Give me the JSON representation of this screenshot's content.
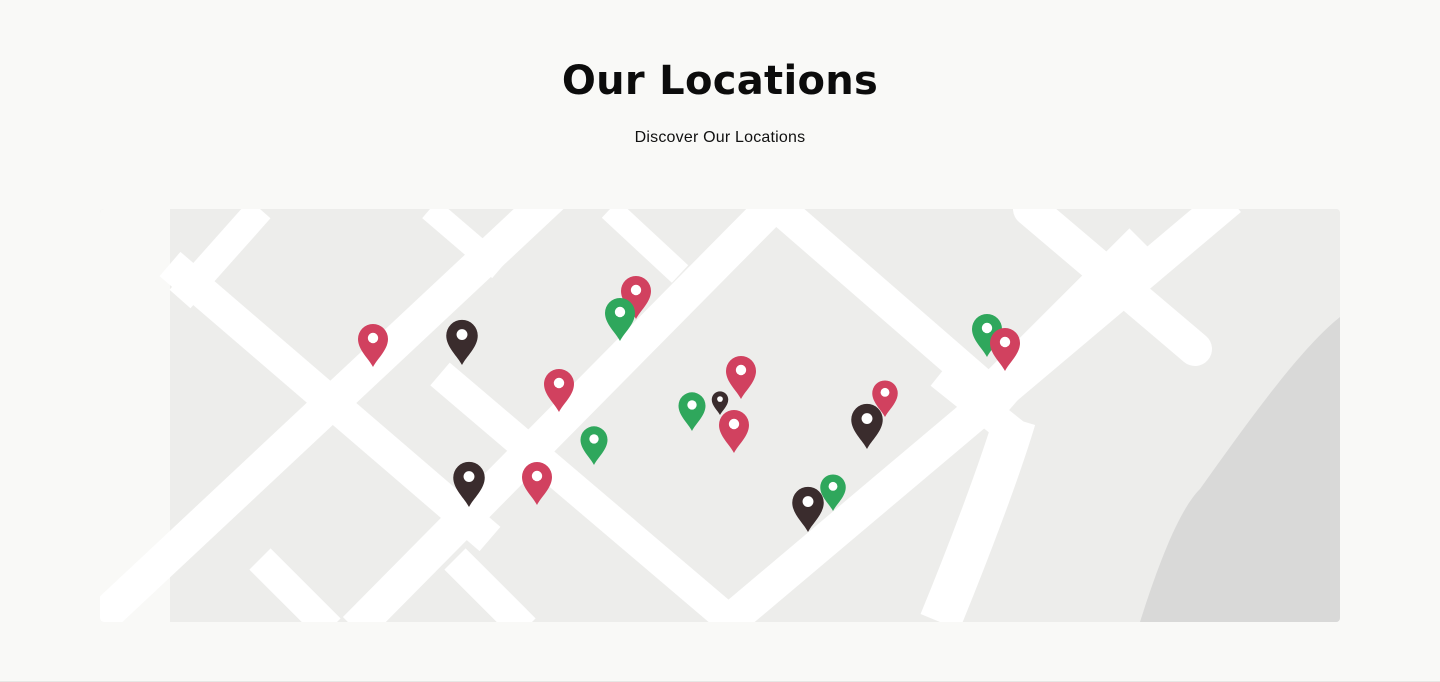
{
  "section": {
    "title": "Our Locations",
    "subtitle": "Discover Our Locations"
  },
  "map": {
    "colors": {
      "background": "#ededeb",
      "road": "#ffffff",
      "water": "#d9d9d8",
      "pin_red": "#d1415f",
      "pin_green": "#2fa75c",
      "pin_dark": "#3a2c2d"
    },
    "markers": [
      {
        "id": "marker-1",
        "category": "red",
        "icon": "map-pin-icon"
      },
      {
        "id": "marker-2",
        "category": "dark",
        "icon": "map-pin-icon"
      },
      {
        "id": "marker-3",
        "category": "red",
        "icon": "map-pin-icon"
      },
      {
        "id": "marker-4",
        "category": "green",
        "icon": "map-pin-icon"
      },
      {
        "id": "marker-5",
        "category": "red",
        "icon": "map-pin-icon"
      },
      {
        "id": "marker-6",
        "category": "green",
        "icon": "map-pin-icon"
      },
      {
        "id": "marker-7",
        "category": "dark",
        "icon": "map-pin-icon"
      },
      {
        "id": "marker-8",
        "category": "red",
        "icon": "map-pin-icon"
      },
      {
        "id": "marker-9",
        "category": "red",
        "icon": "map-pin-icon"
      },
      {
        "id": "marker-10",
        "category": "green",
        "icon": "map-pin-icon"
      },
      {
        "id": "marker-11",
        "category": "dark",
        "icon": "map-pin-icon"
      },
      {
        "id": "marker-12",
        "category": "red",
        "icon": "map-pin-icon"
      },
      {
        "id": "marker-13",
        "category": "red",
        "icon": "map-pin-icon"
      },
      {
        "id": "marker-14",
        "category": "dark",
        "icon": "map-pin-icon"
      },
      {
        "id": "marker-15",
        "category": "dark",
        "icon": "map-pin-icon"
      },
      {
        "id": "marker-16",
        "category": "green",
        "icon": "map-pin-icon"
      },
      {
        "id": "marker-17",
        "category": "green",
        "icon": "map-pin-icon"
      },
      {
        "id": "marker-18",
        "category": "red",
        "icon": "map-pin-icon"
      }
    ]
  }
}
